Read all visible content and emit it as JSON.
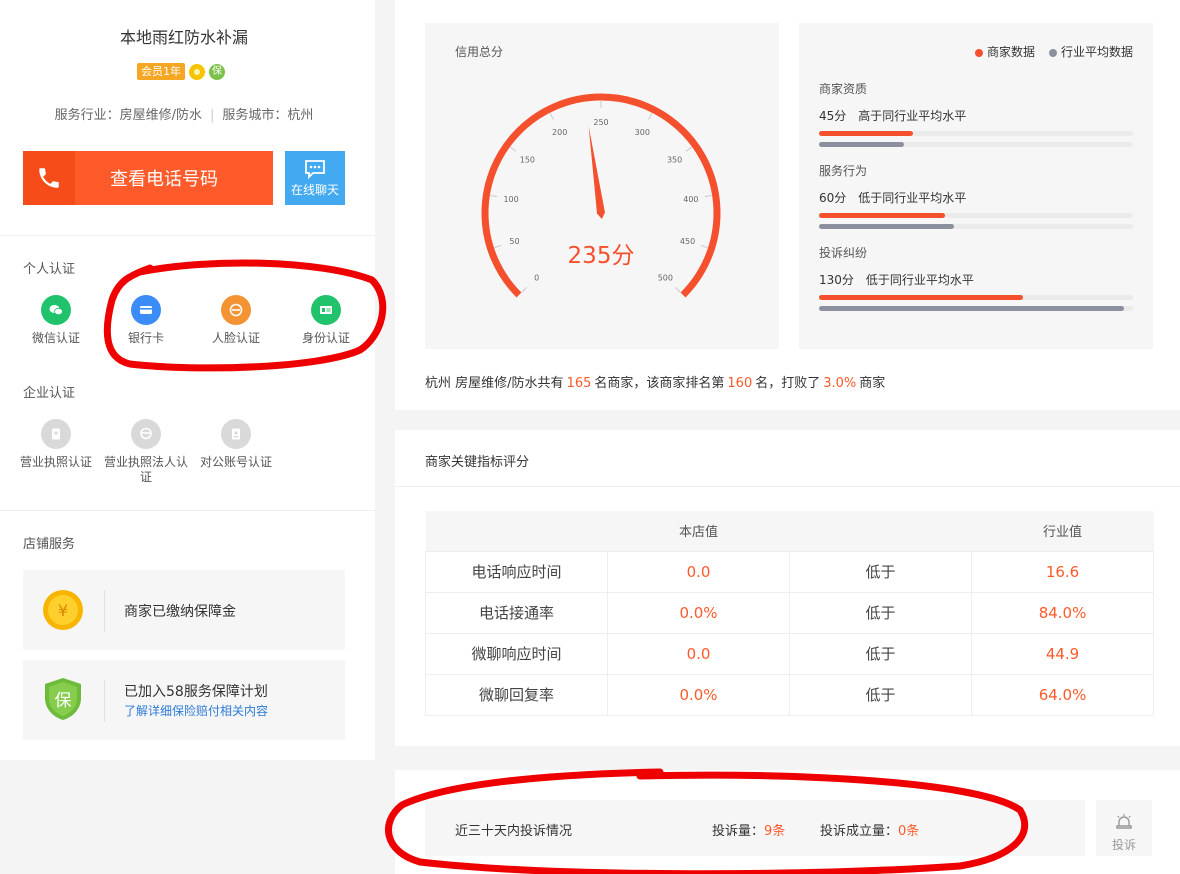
{
  "shop": {
    "name": "本地雨红防水补漏",
    "member_badge": "会员1年",
    "bao_badge": "保",
    "industry_label": "服务行业：",
    "industry": "房屋维修/防水",
    "city_label": "服务城市：",
    "city": "杭州"
  },
  "actions": {
    "phone_label": "查看电话号码",
    "chat_label": "在线聊天"
  },
  "personal_cert": {
    "title": "个人认证",
    "items": [
      {
        "label": "微信认证",
        "color": "#20c36b",
        "icon": "wechat-icon"
      },
      {
        "label": "银行卡",
        "color": "#3b8cf6",
        "icon": "bank-card-icon"
      },
      {
        "label": "人脸认证",
        "color": "#f39334",
        "icon": "face-icon"
      },
      {
        "label": "身份认证",
        "color": "#20c36b",
        "icon": "id-card-icon"
      }
    ]
  },
  "enterprise_cert": {
    "title": "企业认证",
    "items": [
      {
        "label": "营业执照认证",
        "color": "#d9d9d9",
        "icon": "license-icon"
      },
      {
        "label": "营业执照法人认证",
        "color": "#d9d9d9",
        "icon": "legal-person-icon"
      },
      {
        "label": "对公账号认证",
        "color": "#d9d9d9",
        "icon": "account-icon"
      }
    ]
  },
  "store_service": {
    "title": "店铺服务",
    "deposit": "商家已缴纳保障金",
    "plan": "已加入58服务保障计划",
    "plan_link": "了解详细保险赔付相关内容",
    "coin_symbol": "¥",
    "shield_symbol": "保"
  },
  "credit": {
    "title": "信用总分",
    "score_text": "235分",
    "score": 235,
    "max": 500,
    "ticks": [
      "0",
      "50",
      "100",
      "150",
      "200",
      "250",
      "300",
      "350",
      "400",
      "450",
      "500"
    ]
  },
  "stats": {
    "legend_merchant": "商家数据",
    "legend_industry": "行业平均数据",
    "merchant_color": "#f5502d",
    "industry_color": "#8b8f9e",
    "groups": [
      {
        "name": "商家资质",
        "score": "45分",
        "desc": "高于同行业平均水平",
        "merchant": 0.3,
        "industry": 0.27
      },
      {
        "name": "服务行为",
        "score": "60分",
        "desc": "低于同行业平均水平",
        "merchant": 0.4,
        "industry": 0.43
      },
      {
        "name": "投诉纠纷",
        "score": "130分",
        "desc": "低于同行业平均水平",
        "merchant": 0.65,
        "industry": 0.97
      }
    ]
  },
  "ranking": {
    "city": "杭州",
    "industry": "房屋维修/防水",
    "text1": "共有",
    "total": "165",
    "text2": "名商家，该商家排名第",
    "rank": "160",
    "text3": "名，打败了",
    "percent": "3.0%",
    "text4": "商家"
  },
  "kpi": {
    "title": "商家关键指标评分",
    "col_store": "本店值",
    "col_industry": "行业值",
    "rows": [
      {
        "name": "电话响应时间",
        "store": "0.0",
        "cmp": "低于",
        "industry": "16.6"
      },
      {
        "name": "电话接通率",
        "store": "0.0%",
        "cmp": "低于",
        "industry": "84.0%"
      },
      {
        "name": "微聊响应时间",
        "store": "0.0",
        "cmp": "低于",
        "industry": "44.9"
      },
      {
        "name": "微聊回复率",
        "store": "0.0%",
        "cmp": "低于",
        "industry": "64.0%"
      }
    ]
  },
  "complaints": {
    "title": "近三十天内投诉情况",
    "count_label": "投诉量：",
    "count": "9条",
    "valid_label": "投诉成立量：",
    "valid": "0条",
    "button": "投诉"
  }
}
